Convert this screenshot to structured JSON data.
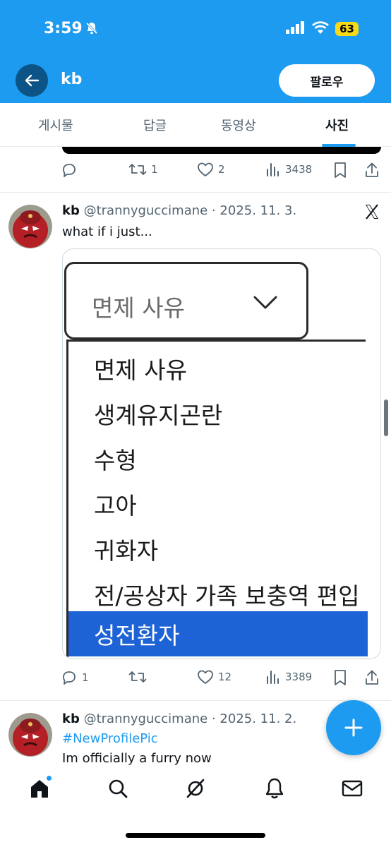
{
  "status_bar": {
    "time": "3:59",
    "battery": "63"
  },
  "header": {
    "title": "kb",
    "follow_label": "팔로우"
  },
  "tabs": [
    {
      "label": "게시물"
    },
    {
      "label": "답글"
    },
    {
      "label": "동영상"
    },
    {
      "label": "사진",
      "active": true
    }
  ],
  "prev_tweet": {
    "retweets": "1",
    "likes": "2",
    "views": "3438"
  },
  "tweet1": {
    "name": "kb",
    "handle": "@trannyguccimane",
    "date": "· 2025. 11. 3.",
    "text": "what if i just...",
    "media": {
      "select_value": "면제 사유",
      "options": [
        "면제 사유",
        "생계유지곤란",
        "수형",
        "고아",
        "귀화자",
        "전/공상자 가족 보충역 편입",
        "성전환자"
      ],
      "selected_option": "성전환자"
    },
    "replies": "1",
    "likes": "12",
    "views": "3389"
  },
  "tweet2": {
    "name": "kb",
    "handle": "@trannyguccimane",
    "date": "· 2025. 11. 2.",
    "hashtag": "#NewProfilePic",
    "text": "Im officially a furry now"
  },
  "colors": {
    "accent": "#1d9bf0",
    "selected_option": "#1e63d6"
  },
  "icons": [
    "back-arrow-icon",
    "reply-icon",
    "retweet-icon",
    "like-icon",
    "views-icon",
    "bookmark-icon",
    "share-icon",
    "x-logo-icon",
    "compose-plus-icon",
    "home-icon",
    "search-icon",
    "grok-icon",
    "notifications-icon",
    "messages-icon"
  ]
}
